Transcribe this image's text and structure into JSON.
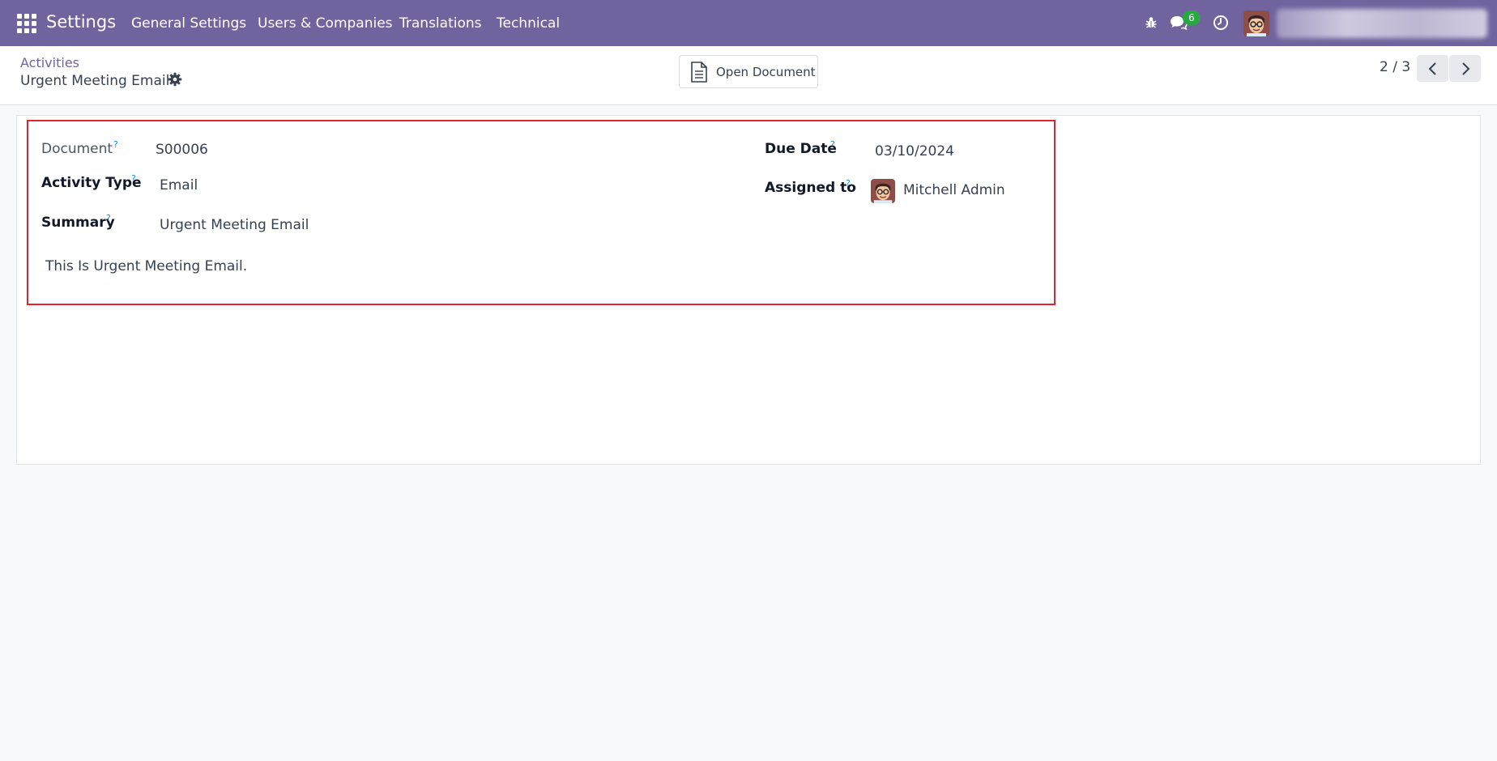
{
  "navbar": {
    "brand": "Settings",
    "menus": [
      "General Settings",
      "Users & Companies",
      "Translations",
      "Technical"
    ],
    "messages_count": "6",
    "user_name": "",
    "accent_color": "#71639e"
  },
  "control_panel": {
    "breadcrumb": "Activities",
    "title": "Urgent Meeting Email",
    "open_document_label": "Open Document",
    "pager": "2 / 3"
  },
  "form": {
    "document_label": "Document",
    "document_value": "S00006",
    "activity_type_label": "Activity Type",
    "activity_type_value": "Email",
    "summary_label": "Summary",
    "summary_value": "Urgent Meeting Email",
    "due_date_label": "Due Date",
    "due_date_value": "03/10/2024",
    "assigned_to_label": "Assigned to",
    "assigned_to_value": "Mitchell Admin",
    "help_mark": "?",
    "note": "This Is Urgent Meeting Email."
  },
  "highlight_color": "#e5232f"
}
